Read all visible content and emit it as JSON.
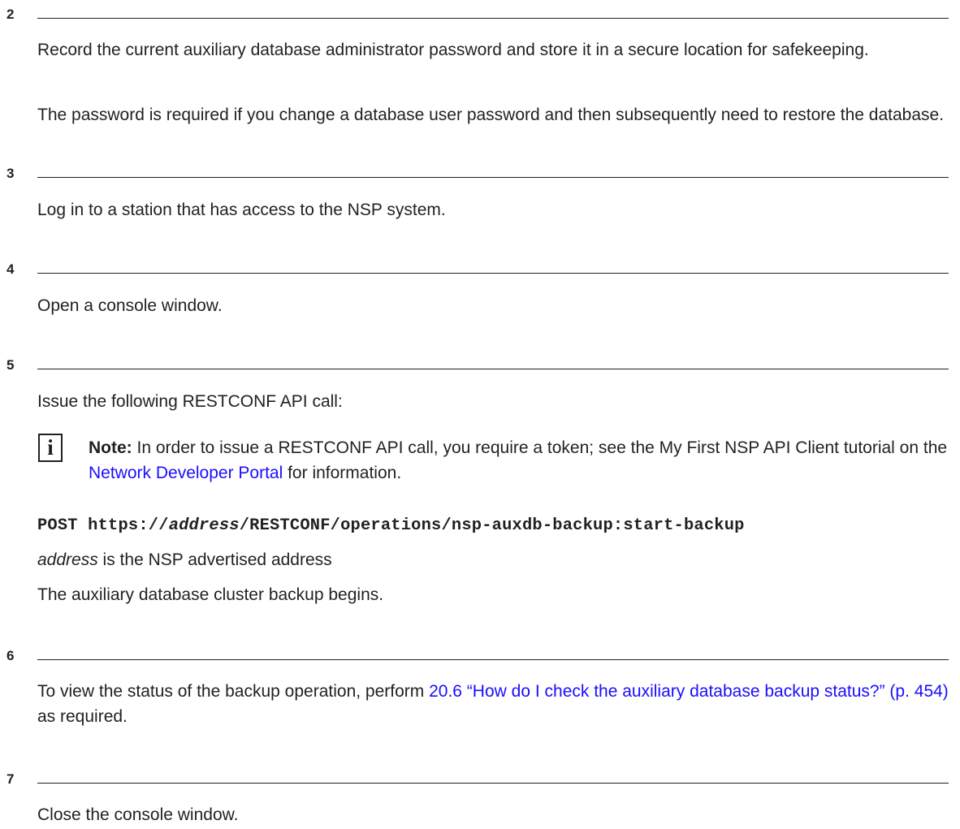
{
  "steps": [
    {
      "number": "2",
      "paragraphs": [
        "Record the current auxiliary database administrator password and store it in a secure location for safekeeping.",
        "The password is required if you change a database user password and then subsequently need to restore the database."
      ]
    },
    {
      "number": "3",
      "paragraphs": [
        "Log in to a station that has access to the NSP system."
      ]
    },
    {
      "number": "4",
      "paragraphs": [
        "Open a console window."
      ]
    },
    {
      "number": "5",
      "intro": "Issue the following RESTCONF API call:",
      "note": {
        "icon": "info-icon",
        "label": "Note:",
        "text_before": "In order to issue a RESTCONF API call, you require a token; see the My First NSP API Client tutorial on the ",
        "link": "Network Developer Portal",
        "text_after": " for information."
      },
      "command": {
        "prefix": "POST https://",
        "variable": "address",
        "suffix": "/RESTCONF/operations/nsp-auxdb-backup:start-backup"
      },
      "where": {
        "variable": "address",
        "text": " is the NSP advertised address"
      },
      "result": "The auxiliary database cluster backup begins."
    },
    {
      "number": "6",
      "text_before": "To view the status of the backup operation, perform ",
      "link": "20.6 “How do I check the auxiliary database backup status?” (p. 454)",
      "text_after": " as required."
    },
    {
      "number": "7",
      "paragraphs": [
        "Close the console window."
      ]
    }
  ]
}
